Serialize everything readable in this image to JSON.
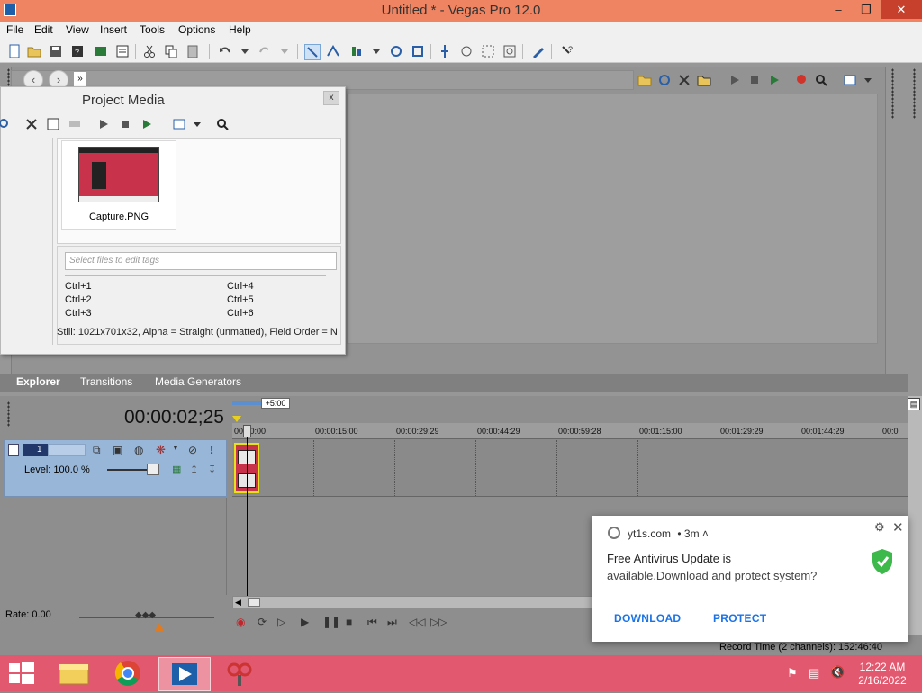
{
  "window": {
    "title": "Untitled * - Vegas Pro 12.0",
    "controls": [
      "–",
      "❐",
      "✕"
    ]
  },
  "menu": [
    "File",
    "Edit",
    "View",
    "Insert",
    "Tools",
    "Options",
    "Help"
  ],
  "dock_tabs": [
    "Explorer",
    "Transitions",
    "Media Generators"
  ],
  "project_media": {
    "title": "Project Media",
    "close_label": "x",
    "thumbnail_name": "Capture.PNG",
    "tag_placeholder": "Select files to edit tags",
    "shortcuts": [
      "Ctrl+1",
      "Ctrl+2",
      "Ctrl+3",
      "Ctrl+4",
      "Ctrl+5",
      "Ctrl+6"
    ],
    "status": "Still: 1021x701x32, Alpha = Straight (unmatted), Field Order = N"
  },
  "timeline": {
    "timecode": "00:00:02;25",
    "marker": "+5:00",
    "track_number": "1",
    "level": "Level: 100.0 %",
    "rate": "Rate: 0.00",
    "ruler_ticks": [
      "00:00:00",
      "00:00:15:00",
      "00:00:29:29",
      "00:00:44:29",
      "00:00:59:28",
      "00:01:15:00",
      "00:01:29:29",
      "00:01:44:29",
      "00:0"
    ],
    "record_time": "Record Time (2 channels): 152:46:40"
  },
  "notification": {
    "site": "yt1s.com",
    "age": "• 3m ˄",
    "title": "Free Antivirus Update is",
    "body": "available.Download and protect system?",
    "buttons": [
      "DOWNLOAD",
      "PROTECT"
    ]
  },
  "taskbar": {
    "time": "12:22 AM",
    "date": "2/16/2022"
  },
  "colors": {
    "titlebar": "#ee8462",
    "taskbar": "#e2586e",
    "track_header": "#98b6d8",
    "clip_border": "#e6e020",
    "link_blue": "#1a73e8"
  }
}
